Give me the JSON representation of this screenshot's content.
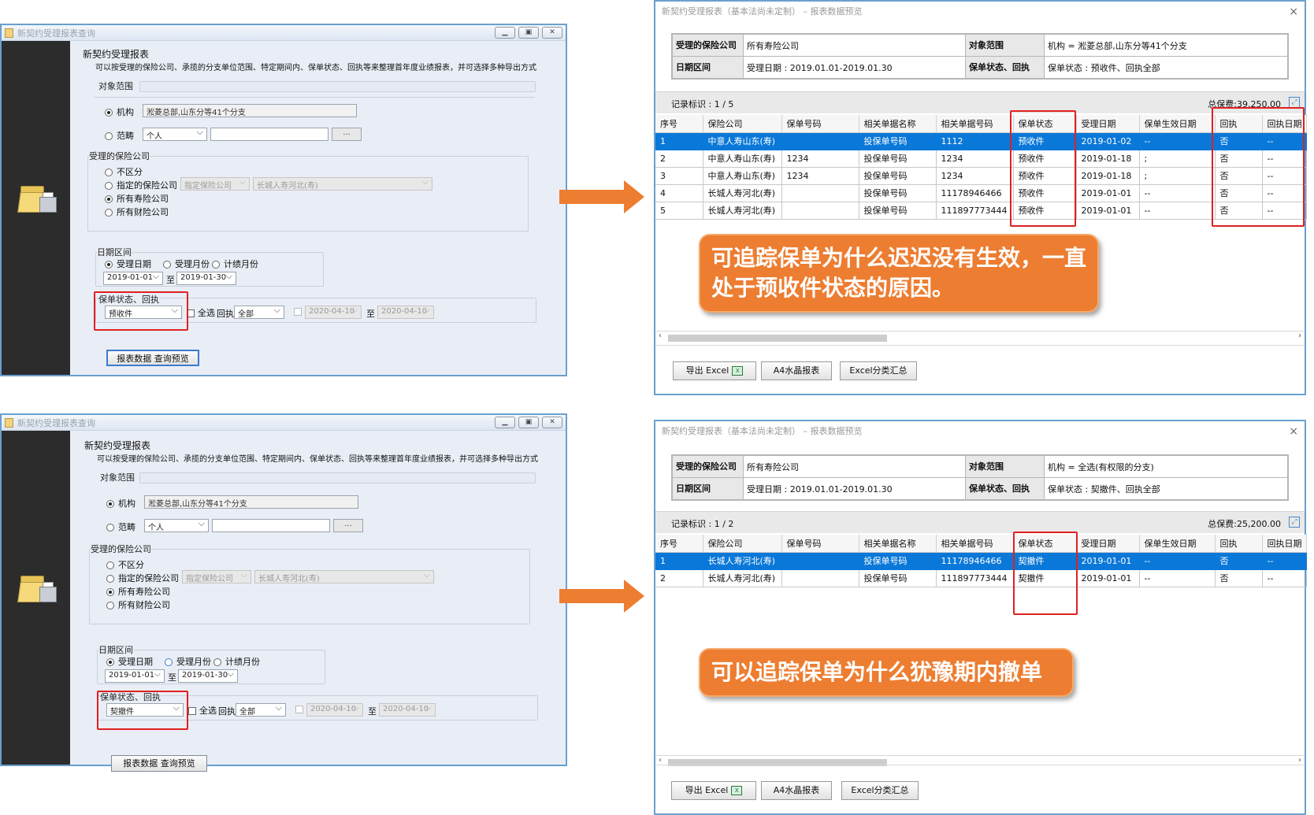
{
  "query_panels": [
    {
      "window_title": "新契约受理报表查询",
      "heading": "新契约受理报表",
      "description": "可以按受理的保险公司、承揽的分支单位范围、特定期间内、保单状态、回执等来整理首年度业绩报表，并可选择多种导出方式",
      "scope_group": "对象范围",
      "radio_org": "机构",
      "org_value": "淞菱总部,山东分等41个分支",
      "radio_category": "范畴",
      "category_value": "个人",
      "category_text": "",
      "dots_label": "...",
      "insurer_group": "受理的保险公司",
      "insurer_options": [
        "不区分",
        "指定的保险公司",
        "所有寿险公司",
        "所有财险公司"
      ],
      "insurer_select_placeholder": "指定保险公司",
      "insurer_select_value": "长城人寿河北(寿)",
      "date_group": "日期区间",
      "date_options": [
        "受理日期",
        "受理月份",
        "计绩月份"
      ],
      "date_from": "2019-01-01",
      "date_to_label": "至",
      "date_to": "2019-01-30",
      "status_group": "保单状态、回执",
      "status_value": "预收件",
      "select_all_label": "全选",
      "receipt_label": "回执",
      "receipt_value": "全部",
      "receipt_date_from": "2020-04-10",
      "receipt_date_to": "2020-04-10",
      "query_button": "报表数据 查询预览"
    },
    {
      "window_title": "新契约受理报表查询",
      "heading": "新契约受理报表",
      "description": "可以按受理的保险公司、承揽的分支单位范围、特定期间内、保单状态、回执等来整理首年度业绩报表，并可选择多种导出方式",
      "scope_group": "对象范围",
      "radio_org": "机构",
      "org_value": "淞菱总部,山东分等41个分支",
      "radio_category": "范畴",
      "category_value": "个人",
      "category_text": "",
      "dots_label": "...",
      "insurer_group": "受理的保险公司",
      "insurer_options": [
        "不区分",
        "指定的保险公司",
        "所有寿险公司",
        "所有财险公司"
      ],
      "insurer_select_placeholder": "指定保险公司",
      "insurer_select_value": "长城人寿河北(寿)",
      "date_group": "日期区间",
      "date_options": [
        "受理日期",
        "受理月份",
        "计绩月份"
      ],
      "date_from": "2019-01-01",
      "date_to_label": "至",
      "date_to": "2019-01-30",
      "status_group": "保单状态、回执",
      "status_value": "契撤件",
      "select_all_label": "全选",
      "receipt_label": "回执",
      "receipt_value": "全部",
      "receipt_date_from": "2020-04-10",
      "receipt_date_to": "2020-04-10",
      "query_button": "报表数据 查询预览"
    }
  ],
  "report_panels": [
    {
      "window_title": "新契约受理报表（基本法尚未定制） – 报表数据预览",
      "close_icon": "×",
      "hdr_insurer_label": "受理的保险公司",
      "hdr_insurer_value": "所有寿险公司",
      "hdr_scope_label": "对象范围",
      "hdr_scope_value": "机构 = 淞菱总部,山东分等41个分支",
      "hdr_date_label": "日期区间",
      "hdr_date_value": "受理日期 : 2019.01.01-2019.01.30",
      "hdr_status_label": "保单状态、回执",
      "hdr_status_value": "保单状态 : 预收件、回执全部",
      "record_label": "记录标识 : 1 / 5",
      "total_premium": "总保费:39,250.00",
      "columns": [
        "序号",
        "保险公司",
        "保单号码",
        "相关单据名称",
        "相关单据号码",
        "保单状态",
        "受理日期",
        "保单生效日期",
        "回执",
        "回执日期"
      ],
      "rows": [
        [
          "1",
          "中意人寿山东(寿)",
          "",
          "投保单号码",
          "1112",
          "预收件",
          "2019-01-02",
          "--",
          "否",
          "--"
        ],
        [
          "2",
          "中意人寿山东(寿)",
          "1234",
          "投保单号码",
          "1234",
          "预收件",
          "2019-01-18",
          ";",
          "否",
          "--"
        ],
        [
          "3",
          "中意人寿山东(寿)",
          "1234",
          "投保单号码",
          "1234",
          "预收件",
          "2019-01-18",
          ";",
          "否",
          "--"
        ],
        [
          "4",
          "长城人寿河北(寿)",
          "",
          "投保单号码",
          "11178946466",
          "预收件",
          "2019-01-01",
          "--",
          "否",
          "--"
        ],
        [
          "5",
          "长城人寿河北(寿)",
          "",
          "投保单号码",
          "111897773444",
          "预收件",
          "2019-01-01",
          "--",
          "否",
          "--"
        ]
      ],
      "btn_export_excel": "导出 Excel",
      "btn_a4": "A4水晶报表",
      "btn_excel_summary": "Excel分类汇总",
      "callout": "可追踪保单为什么迟迟没有生效，一直处于预收件状态的原因。"
    },
    {
      "window_title": "新契约受理报表（基本法尚未定制） – 报表数据预览",
      "close_icon": "×",
      "hdr_insurer_label": "受理的保险公司",
      "hdr_insurer_value": "所有寿险公司",
      "hdr_scope_label": "对象范围",
      "hdr_scope_value": "机构 = 全选(有权限的分支)",
      "hdr_date_label": "日期区间",
      "hdr_date_value": "受理日期 : 2019.01.01-2019.01.30",
      "hdr_status_label": "保单状态、回执",
      "hdr_status_value": "保单状态 : 契撤件、回执全部",
      "record_label": "记录标识 : 1 / 2",
      "total_premium": "总保费:25,200.00",
      "columns": [
        "序号",
        "保险公司",
        "保单号码",
        "相关单据名称",
        "相关单据号码",
        "保单状态",
        "受理日期",
        "保单生效日期",
        "回执",
        "回执日期"
      ],
      "rows": [
        [
          "1",
          "长城人寿河北(寿)",
          "",
          "投保单号码",
          "11178946466",
          "契撤件",
          "2019-01-01",
          "--",
          "否",
          "--"
        ],
        [
          "2",
          "长城人寿河北(寿)",
          "",
          "投保单号码",
          "111897773444",
          "契撤件",
          "2019-01-01",
          "--",
          "否",
          "--"
        ]
      ],
      "btn_export_excel": "导出 Excel",
      "btn_a4": "A4水晶报表",
      "btn_excel_summary": "Excel分类汇总",
      "callout": "可以追踪保单为什么犹豫期内撤单"
    }
  ],
  "icons": {
    "arrow": "right-arrow-icon",
    "folder": "folder-printer-icon",
    "excel": "excel-icon",
    "expand": "fullscreen-icon"
  },
  "colors": {
    "accent_orange": "#ed7d31",
    "selection_blue": "#0a78d8",
    "highlight_red": "#e02020",
    "window_border": "#6aa0cf"
  }
}
